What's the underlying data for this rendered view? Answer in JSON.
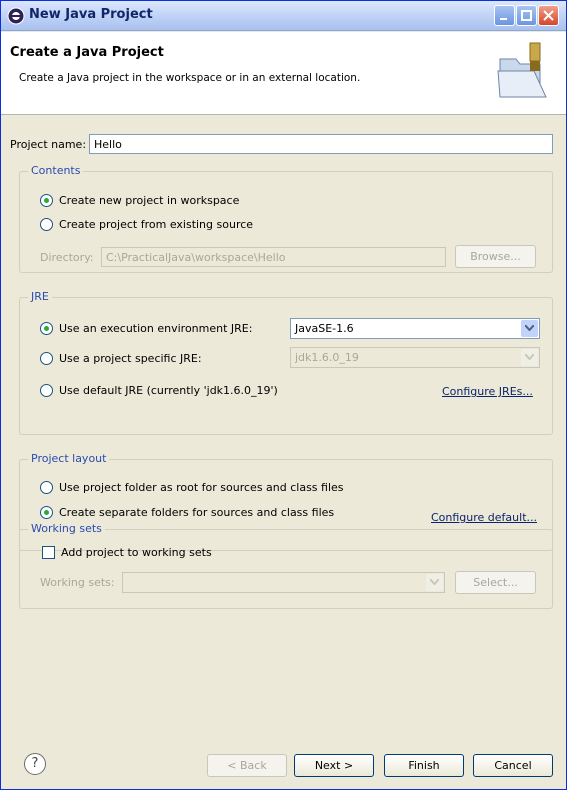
{
  "window": {
    "title": "New Java Project"
  },
  "header": {
    "title": "Create a Java Project",
    "description": "Create a Java project in the workspace or in an external location."
  },
  "project_name": {
    "label": "Project name:",
    "value": "Hello"
  },
  "contents": {
    "legend": "Contents",
    "radio_new": "Create new project in workspace",
    "radio_existing": "Create project from existing source",
    "selected": "radio_new",
    "directory_label": "Directory:",
    "directory_value": "C:\\PracticalJava\\workspace\\Hello",
    "browse_label": "Browse..."
  },
  "jre": {
    "legend": "JRE",
    "radio_exec_env": "Use an execution environment JRE:",
    "exec_env_value": "JavaSE-1.6",
    "radio_specific": "Use a project specific JRE:",
    "specific_value": "jdk1.6.0_19",
    "radio_default": "Use default JRE (currently 'jdk1.6.0_19')",
    "configure_link": "Configure JREs...",
    "selected": "radio_exec_env"
  },
  "layout": {
    "legend": "Project layout",
    "radio_root": "Use project folder as root for sources and class files",
    "radio_separate": "Create separate folders for sources and class files",
    "configure_link": "Configure default...",
    "selected": "radio_separate"
  },
  "working_sets": {
    "legend": "Working sets",
    "checkbox_label": "Add project to working sets",
    "checked": false,
    "sets_label": "Working sets:",
    "select_label": "Select..."
  },
  "footer": {
    "help_symbol": "?",
    "back_label": "< Back",
    "next_label": "Next >",
    "finish_label": "Finish",
    "cancel_label": "Cancel"
  },
  "colors": {
    "accent": "#0a246a",
    "radio_selected": "#2aa83a",
    "group_legend": "#2a4bb0"
  }
}
